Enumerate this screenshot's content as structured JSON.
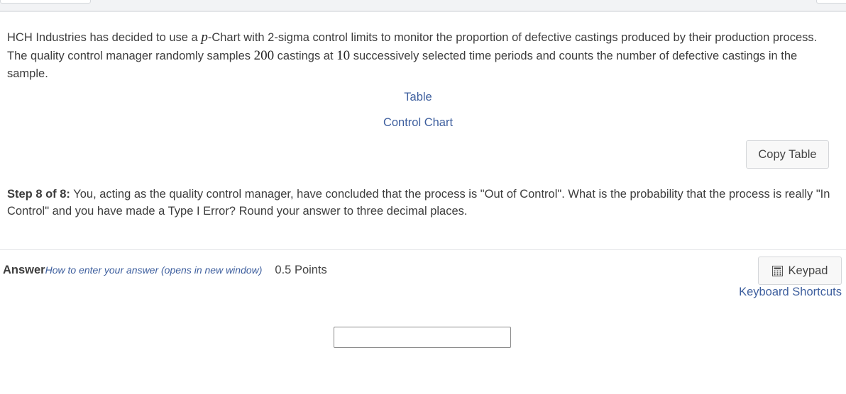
{
  "question": {
    "intro_part1": "HCH Industries has decided to use a ",
    "chart_symbol": "p",
    "intro_part2": "-Chart with 2-sigma control limits to monitor the proportion of defective castings produced by their production process. The quality control manager randomly samples ",
    "sample_size": "200",
    "intro_part3": " castings at ",
    "num_periods": "10",
    "intro_part4": " successively selected time periods and counts the number of defective castings in the sample."
  },
  "links": {
    "table": "Table",
    "control_chart": "Control Chart"
  },
  "copy_table_label": "Copy Table",
  "step": {
    "label": "Step 8 of 8:",
    "text": " You, acting as the quality control manager, have concluded that the process is \"Out of Control\". What is the probability that the process is really \"In Control\" and you have made a Type I Error? Round your answer to three decimal places."
  },
  "answer": {
    "label": "Answer",
    "help_link": "How to enter your answer (opens in new window)",
    "points": "0.5 Points",
    "keypad_label": "Keypad",
    "keypad_icon": "calculator-icon",
    "shortcuts_link": "Keyboard Shortcuts",
    "input_value": ""
  }
}
